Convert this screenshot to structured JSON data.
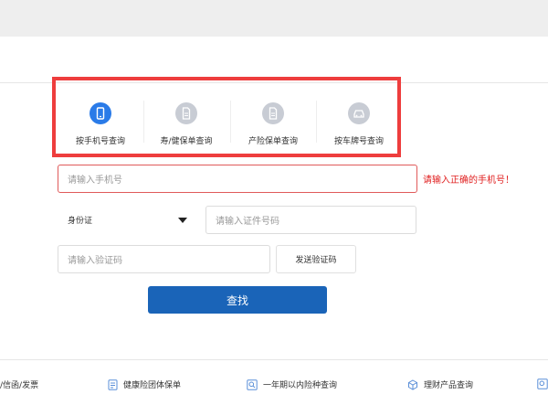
{
  "tabs": [
    {
      "label": "按手机号查询",
      "icon": "phone-icon",
      "active": true
    },
    {
      "label": "寿/健保单查询",
      "icon": "document-icon",
      "active": false
    },
    {
      "label": "产险保单查询",
      "icon": "document-icon",
      "active": false
    },
    {
      "label": "按车牌号查询",
      "icon": "car-icon",
      "active": false
    }
  ],
  "form": {
    "phone_placeholder": "请输入手机号",
    "phone_error": "请输入正确的手机号！",
    "id_type_selected": "身份证",
    "id_number_placeholder": "请输入证件号码",
    "code_placeholder": "请输入验证码",
    "send_code_label": "发送验证码",
    "search_label": "查找"
  },
  "footer": {
    "items": [
      {
        "label": "/信函/发票",
        "icon": ""
      },
      {
        "label": "健康险团体保单",
        "icon": "document-list-icon"
      },
      {
        "label": "一年期以内险种查询",
        "icon": "search-icon"
      },
      {
        "label": "理财产品查询",
        "icon": "cube-icon"
      }
    ]
  },
  "colors": {
    "accent": "#2a7be8",
    "button": "#1a64b8",
    "error": "#e02020",
    "highlight": "#ee3d3d"
  }
}
